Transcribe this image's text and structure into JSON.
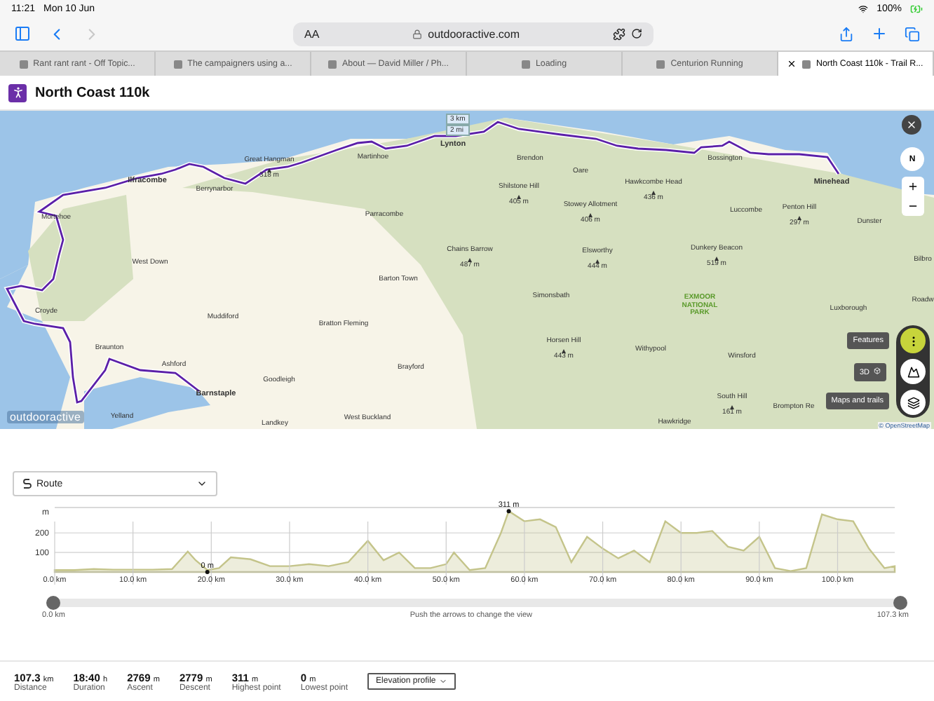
{
  "status_bar": {
    "time": "11:21",
    "date": "Mon 10 Jun",
    "battery": "100%"
  },
  "browser": {
    "text_size": "AA",
    "url": "outdooractive.com",
    "forward_disabled": true
  },
  "tabs": [
    {
      "label": "Rant rant rant - Off Topic...",
      "selected": false
    },
    {
      "label": "The campaigners using a...",
      "selected": false
    },
    {
      "label": "About — David Miller / Ph...",
      "selected": false
    },
    {
      "label": "Loading",
      "selected": false
    },
    {
      "label": "Centurion Running",
      "selected": false
    },
    {
      "label": "North Coast 110k - Trail R...",
      "selected": true
    }
  ],
  "page": {
    "title": "North Coast 110k"
  },
  "map": {
    "scale": [
      "3 km",
      "2 mi"
    ],
    "compass": "N",
    "logo": "outdooractive",
    "attribution": "© OpenStreetMap",
    "labels": [
      {
        "text": "Ilfracombe",
        "kind": "town"
      },
      {
        "text": "Mortehoe",
        "kind": "place"
      },
      {
        "text": "Berrynarbor",
        "kind": "place"
      },
      {
        "text": "Great Hangman",
        "kind": "peak",
        "height": "318 m"
      },
      {
        "text": "Martinhoe",
        "kind": "place"
      },
      {
        "text": "Lynton",
        "kind": "town"
      },
      {
        "text": "Parracombe",
        "kind": "place"
      },
      {
        "text": "West Down",
        "kind": "place"
      },
      {
        "text": "Barton Town",
        "kind": "place"
      },
      {
        "text": "Croyde",
        "kind": "place"
      },
      {
        "text": "Muddiford",
        "kind": "place"
      },
      {
        "text": "Bratton Fleming",
        "kind": "place"
      },
      {
        "text": "Braunton",
        "kind": "place"
      },
      {
        "text": "Ashford",
        "kind": "place"
      },
      {
        "text": "Brayford",
        "kind": "place"
      },
      {
        "text": "Goodleigh",
        "kind": "place"
      },
      {
        "text": "Barnstaple",
        "kind": "town"
      },
      {
        "text": "Yelland",
        "kind": "place"
      },
      {
        "text": "Landkey",
        "kind": "place"
      },
      {
        "text": "West Buckland",
        "kind": "place"
      },
      {
        "text": "Brendon",
        "kind": "place"
      },
      {
        "text": "Oare",
        "kind": "place"
      },
      {
        "text": "Shilstone Hill",
        "kind": "peak",
        "height": "405 m"
      },
      {
        "text": "Stowey Allotment",
        "kind": "peak",
        "height": "406 m"
      },
      {
        "text": "Hawkcombe Head",
        "kind": "peak",
        "height": "436 m"
      },
      {
        "text": "Bossington",
        "kind": "place"
      },
      {
        "text": "Minehead",
        "kind": "town"
      },
      {
        "text": "Luccombe",
        "kind": "place"
      },
      {
        "text": "Penton Hill",
        "kind": "peak",
        "height": "297 m"
      },
      {
        "text": "Dunster",
        "kind": "place"
      },
      {
        "text": "Chains Barrow",
        "kind": "peak",
        "height": "487 m"
      },
      {
        "text": "Elsworthy",
        "kind": "peak",
        "height": "444 m"
      },
      {
        "text": "Dunkery Beacon",
        "kind": "peak",
        "height": "519 m"
      },
      {
        "text": "Bilbro",
        "kind": "place"
      },
      {
        "text": "Simonsbath",
        "kind": "place"
      },
      {
        "text": "EXMOOR NATIONAL PARK",
        "kind": "park"
      },
      {
        "text": "Luxborough",
        "kind": "place"
      },
      {
        "text": "Roadw",
        "kind": "place"
      },
      {
        "text": "Horsen Hill",
        "kind": "peak",
        "height": "443 m"
      },
      {
        "text": "Withypool",
        "kind": "place"
      },
      {
        "text": "Winsford",
        "kind": "place"
      },
      {
        "text": "South Hill",
        "kind": "peak",
        "height": "161 m"
      },
      {
        "text": "Hawkridge",
        "kind": "place"
      },
      {
        "text": "Brompton Re",
        "kind": "place"
      }
    ],
    "tooltips": [
      "Features",
      "3D",
      "Maps and trails"
    ]
  },
  "route_select": {
    "value": "Route"
  },
  "elevation": {
    "chart_data": {
      "type": "area",
      "x": [
        0,
        2.5,
        5,
        7.5,
        10,
        12.5,
        15,
        17,
        18,
        19.5,
        21,
        22.5,
        25,
        27.5,
        30,
        32.5,
        35,
        37.5,
        40,
        42,
        44,
        46,
        48,
        50,
        51,
        53,
        55,
        57,
        58,
        60,
        62,
        64,
        66,
        68,
        70,
        72,
        74,
        76,
        78,
        80,
        82,
        84,
        86,
        88,
        90,
        92,
        94,
        96,
        98,
        100,
        102,
        104,
        106,
        107.3
      ],
      "series": [
        {
          "color": "#c4c48a",
          "values": [
            10,
            10,
            15,
            12,
            12,
            12,
            15,
            105,
            60,
            10,
            20,
            75,
            65,
            30,
            30,
            40,
            30,
            50,
            160,
            60,
            100,
            20,
            20,
            40,
            100,
            10,
            20,
            200,
            311,
            260,
            270,
            230,
            50,
            180,
            120,
            70,
            110,
            50,
            260,
            200,
            200,
            210,
            130,
            110,
            180,
            20,
            5,
            20,
            295,
            270,
            260,
            120,
            20,
            30
          ]
        }
      ],
      "xlim": [
        0,
        107.3
      ],
      "ylim": [
        0,
        330
      ],
      "ylabel": "m",
      "grid": true,
      "xticks": [
        {
          "value": 0,
          "label": "0.0 km"
        },
        {
          "value": 10,
          "label": "10.0 km"
        },
        {
          "value": 20,
          "label": "20.0 km"
        },
        {
          "value": 30,
          "label": "30.0 km"
        },
        {
          "value": 40,
          "label": "40.0 km"
        },
        {
          "value": 50,
          "label": "50.0 km"
        },
        {
          "value": 60,
          "label": "60.0 km"
        },
        {
          "value": 70,
          "label": "70.0 km"
        },
        {
          "value": 80,
          "label": "80.0 km"
        },
        {
          "value": 90,
          "label": "90.0 km"
        },
        {
          "value": 100,
          "label": "100.0 km"
        }
      ],
      "yticks": [
        100,
        200
      ],
      "annotations": [
        {
          "x": 58,
          "y": 311,
          "text": "311 m"
        },
        {
          "x": 19.5,
          "y": 0,
          "text": "0 m"
        }
      ]
    },
    "slider": {
      "start": "0.0 km",
      "end": "107.3 km",
      "hint": "Push the arrows to change the view"
    }
  },
  "stats": [
    {
      "value": "107.3",
      "unit": "km",
      "label": "Distance"
    },
    {
      "value": "18:40",
      "unit": "h",
      "label": "Duration"
    },
    {
      "value": "2769",
      "unit": "m",
      "label": "Ascent"
    },
    {
      "value": "2779",
      "unit": "m",
      "label": "Descent"
    },
    {
      "value": "311",
      "unit": "m",
      "label": "Highest point"
    },
    {
      "value": "0",
      "unit": "m",
      "label": "Lowest point"
    }
  ],
  "profile_button": "Elevation profile"
}
